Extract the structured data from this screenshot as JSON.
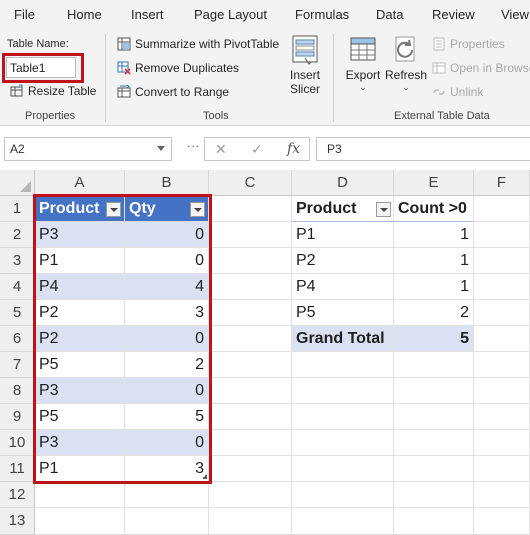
{
  "ribbon_tabs": [
    "File",
    "Home",
    "Insert",
    "Page Layout",
    "Formulas",
    "Data",
    "Review",
    "View"
  ],
  "properties": {
    "table_name_label": "Table Name:",
    "table_name_value": "Table1",
    "resize_label": "Resize Table",
    "group_label": "Properties"
  },
  "tools": {
    "summarize_label": "Summarize with PivotTable",
    "remove_dup_label": "Remove Duplicates",
    "convert_label": "Convert to Range",
    "insert_slicer_line1": "Insert",
    "insert_slicer_line2": "Slicer",
    "group_label": "Tools"
  },
  "external": {
    "export_label": "Export",
    "refresh_label": "Refresh",
    "properties_label": "Properties",
    "open_browser_label": "Open in Browser",
    "unlink_label": "Unlink",
    "group_label": "External Table Data"
  },
  "formula_bar": {
    "name_box": "A2",
    "formula": "P3",
    "fx": "fx"
  },
  "columns": [
    "A",
    "B",
    "C",
    "D",
    "E",
    "F"
  ],
  "rows": [
    "1",
    "2",
    "3",
    "4",
    "5",
    "6",
    "7",
    "8",
    "9",
    "10",
    "11",
    "12",
    "13"
  ],
  "table": {
    "headers": [
      "Product",
      "Qty"
    ],
    "rows": [
      [
        "P3",
        "0"
      ],
      [
        "P1",
        "0"
      ],
      [
        "P4",
        "4"
      ],
      [
        "P2",
        "3"
      ],
      [
        "P2",
        "0"
      ],
      [
        "P5",
        "2"
      ],
      [
        "P3",
        "0"
      ],
      [
        "P5",
        "5"
      ],
      [
        "P3",
        "0"
      ],
      [
        "P1",
        "3"
      ]
    ]
  },
  "pivot": {
    "headers": [
      "Product",
      "Count >0"
    ],
    "rows": [
      [
        "P1",
        "1"
      ],
      [
        "P2",
        "1"
      ],
      [
        "P4",
        "1"
      ],
      [
        "P5",
        "2"
      ]
    ],
    "total": [
      "Grand Total",
      "5"
    ]
  },
  "colors": {
    "table_header": "#4472c4",
    "table_band": "#d9e1f2",
    "highlight_border": "#c0121b"
  }
}
